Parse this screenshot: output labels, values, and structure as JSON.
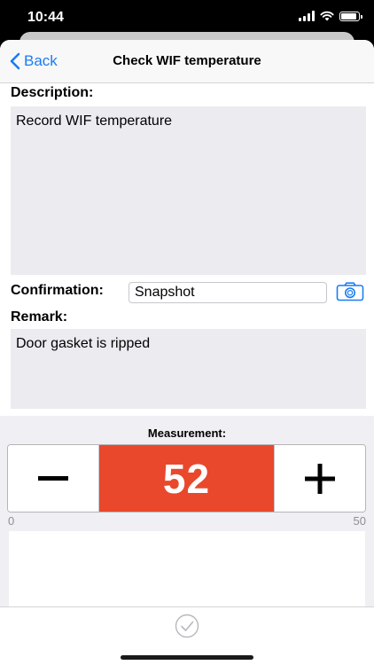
{
  "status_bar": {
    "time": "10:44"
  },
  "nav": {
    "back_label": "Back",
    "title": "Check WIF temperature"
  },
  "description": {
    "label": "Description:",
    "text": "Record WIF temperature"
  },
  "confirmation": {
    "label": "Confirmation:",
    "value": "Snapshot"
  },
  "remark": {
    "label": "Remark:",
    "text": "Door gasket is ripped"
  },
  "measurement": {
    "label": "Measurement:",
    "value": "52",
    "min_label": "0",
    "max_label": "50",
    "minus_icon": "minus-icon",
    "plus_icon": "plus-icon"
  },
  "icons": {
    "camera": "camera-icon",
    "confirm": "checkmark-circle-icon"
  },
  "colors": {
    "accent": "#1a7cf5",
    "value_background": "#e9482c",
    "textbox_background": "#ebebf0"
  }
}
